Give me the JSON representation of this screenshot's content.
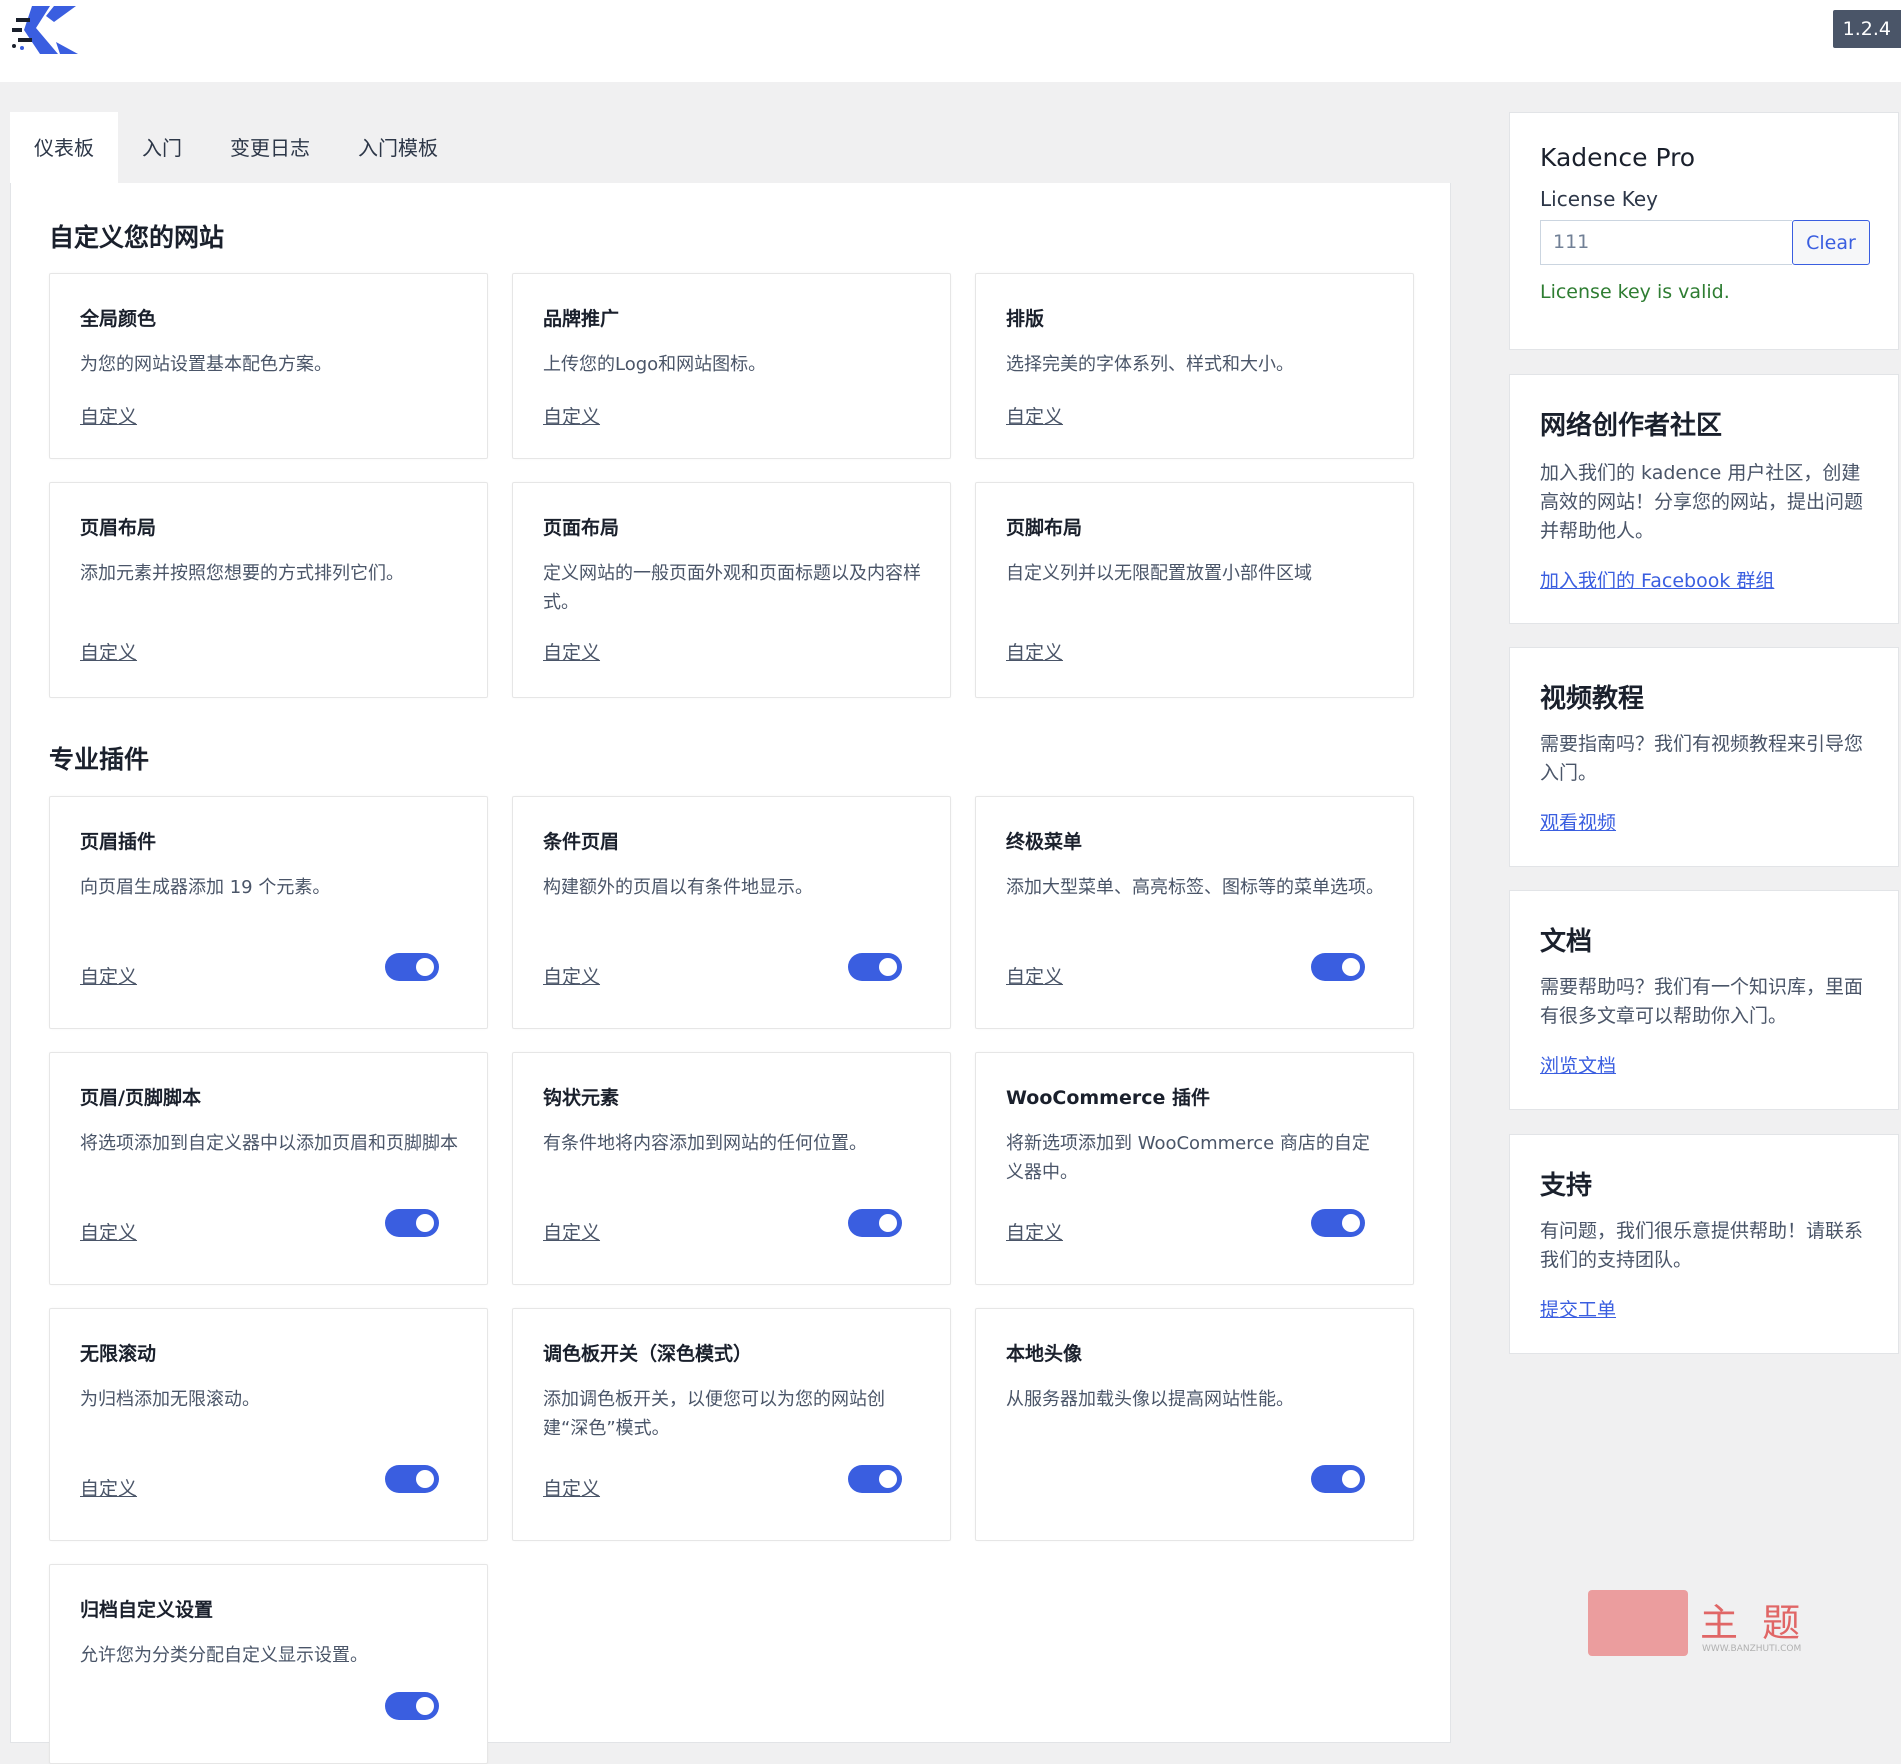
{
  "header": {
    "logo": "kadence-logo-icon",
    "version": "1.2.4"
  },
  "tabs": [
    {
      "label": "仪表板",
      "active": true
    },
    {
      "label": "入门"
    },
    {
      "label": "变更日志"
    },
    {
      "label": "入门模板"
    }
  ],
  "sections": {
    "customize_title": "自定义您的网站",
    "pro_title": "专业插件"
  },
  "customize_cards": [
    {
      "title": "全局颜色",
      "desc": "为您的网站设置基本配色方案。",
      "link": "自定义"
    },
    {
      "title": "品牌推广",
      "desc": "上传您的Logo和网站图标。",
      "link": "自定义"
    },
    {
      "title": "排版",
      "desc": "选择完美的字体系列、样式和大小。",
      "link": "自定义"
    },
    {
      "title": "页眉布局",
      "desc": "添加元素并按照您想要的方式排列它们。",
      "link": "自定义"
    },
    {
      "title": "页面布局",
      "desc": "定义网站的一般页面外观和页面标题以及内容样式。",
      "link": "自定义"
    },
    {
      "title": "页脚布局",
      "desc": "自定义列并以无限配置放置小部件区域",
      "link": "自定义"
    }
  ],
  "pro_cards": [
    {
      "title": "页眉插件",
      "desc": "向页眉生成器添加 19 个元素。",
      "link": "自定义",
      "enabled": true
    },
    {
      "title": "条件页眉",
      "desc": "构建额外的页眉以有条件地显示。",
      "link": "自定义",
      "enabled": true
    },
    {
      "title": "终极菜单",
      "desc": "添加大型菜单、高亮标签、图标等的菜单选项。",
      "link": "自定义",
      "enabled": true
    },
    {
      "title": "页眉/页脚脚本",
      "desc": "将选项添加到自定义器中以添加页眉和页脚脚本",
      "link": "自定义",
      "enabled": true
    },
    {
      "title": "钩状元素",
      "desc": "有条件地将内容添加到网站的任何位置。",
      "link": "自定义",
      "enabled": true
    },
    {
      "title": "WooCommerce 插件",
      "desc": "将新选项添加到 WooCommerce 商店的自定义器中。",
      "link": "自定义",
      "enabled": true
    },
    {
      "title": "无限滚动",
      "desc": "为归档添加无限滚动。",
      "link": "自定义",
      "enabled": true
    },
    {
      "title": "调色板开关（深色模式）",
      "desc": "添加调色板开关，以便您可以为您的网站创建“深色”模式。",
      "link": "自定义",
      "enabled": true
    },
    {
      "title": "本地头像",
      "desc": "从服务器加载头像以提高网站性能。",
      "link": "",
      "enabled": true
    },
    {
      "title": "归档自定义设置",
      "desc": "允许您为分类分配自定义显示设置。",
      "link": "",
      "enabled": true
    }
  ],
  "sidebar": {
    "license": {
      "title": "Kadence Pro",
      "label": "License Key",
      "value": "111",
      "clear_label": "Clear",
      "status": "License key is valid."
    },
    "boxes": [
      {
        "title": "网络创作者社区",
        "desc": "加入我们的 kadence 用户社区，创建高效的网站！分享您的网站，提出问题并帮助他人。",
        "link": "加入我们的 Facebook 群组"
      },
      {
        "title": "视频教程",
        "desc": "需要指南吗？我们有视频教程来引导您入门。",
        "link": "观看视频"
      },
      {
        "title": "文档",
        "desc": "需要帮助吗？我们有一个知识库，里面有很多文章可以帮助你入门。",
        "link": "浏览文档"
      },
      {
        "title": "支持",
        "desc": "有问题，我们很乐意提供帮助！请联系我们的支持团队。",
        "link": "提交工单"
      }
    ]
  },
  "watermark": {
    "text": "主 题",
    "sub": "WWW.BANZHUTI.COM"
  },
  "colors": {
    "accent": "#3a5ee0",
    "valid": "#2e7d32",
    "version_bg": "#4a5568"
  }
}
